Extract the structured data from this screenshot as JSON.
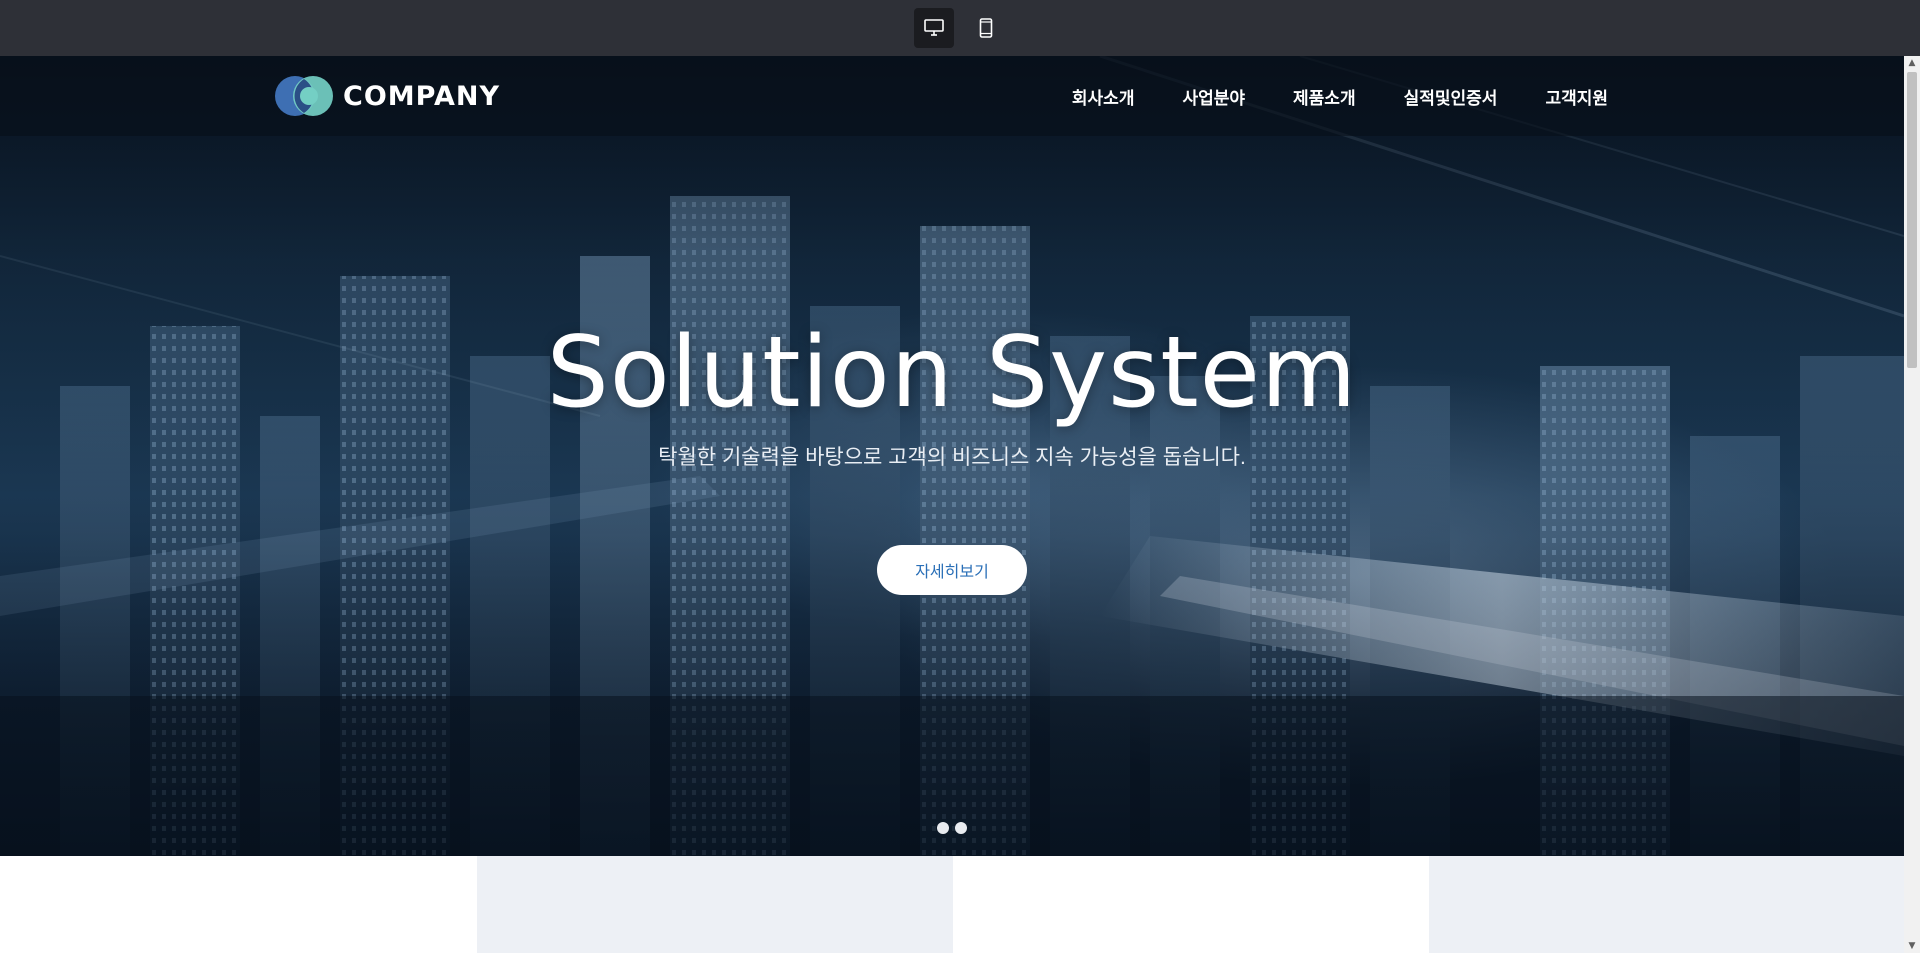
{
  "preview_toolbar": {
    "desktop_icon": "monitor-icon",
    "mobile_icon": "smartphone-icon",
    "active": "desktop"
  },
  "header": {
    "logo_text": "COMPANY",
    "nav": [
      {
        "label": "회사소개"
      },
      {
        "label": "사업분야"
      },
      {
        "label": "제품소개"
      },
      {
        "label": "실적및인증서"
      },
      {
        "label": "고객지원"
      }
    ]
  },
  "hero": {
    "title": "Solution System",
    "subtitle": "탁월한 기술력을 바탕으로 고객의 비즈니스 지속 가능성을 돕습니다.",
    "cta_label": "자세히보기",
    "slides": 2
  },
  "colors": {
    "toolbar_bg": "#2e3037",
    "logo_circle_a": "#3e6fb3",
    "logo_circle_b": "#74cfc4",
    "cta_text": "#2a6fb7",
    "panel_gray": "#edf0f5"
  }
}
